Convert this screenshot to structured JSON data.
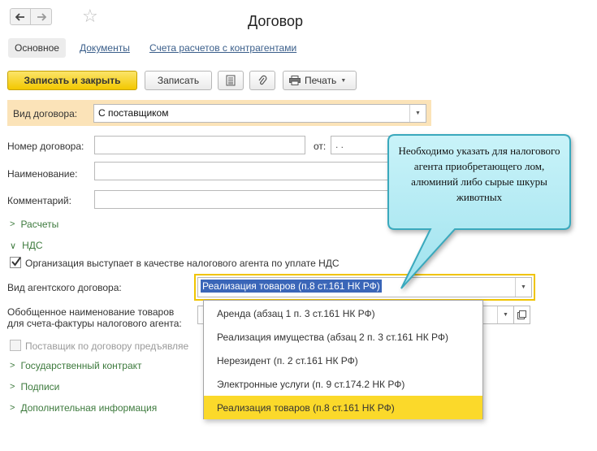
{
  "window": {
    "title": "Договор"
  },
  "nav": {
    "back_icon": "arrow-left-icon",
    "forward_icon": "arrow-right-icon",
    "favorite_icon": "star-icon"
  },
  "tabs": [
    {
      "label": "Основное",
      "active": true
    },
    {
      "label": "Документы",
      "active": false
    },
    {
      "label": "Счета расчетов с контрагентами",
      "active": false
    }
  ],
  "toolbar": {
    "save_close_label": "Записать и закрыть",
    "save_label": "Записать",
    "list_icon": "list-icon",
    "attach_icon": "paperclip-icon",
    "print_label": "Печать"
  },
  "form": {
    "contract_type_label": "Вид договора:",
    "contract_type_value": "С поставщиком",
    "number_label": "Номер договора:",
    "number_value": "",
    "date_label": "от:",
    "date_value": ". .",
    "name_label": "Наименование:",
    "name_value": "",
    "comment_label": "Комментарий:",
    "comment_value": ""
  },
  "sections": {
    "payments": "Расчеты",
    "vat": "НДС",
    "state_contract": "Государственный контракт",
    "signatures": "Подписи",
    "additional": "Дополнительная информация"
  },
  "vat": {
    "agent_checkbox_label": "Организация выступает в качестве налогового агента по уплате НДС",
    "agent_checked": true,
    "agent_contract_label": "Вид агентского договора:",
    "agent_contract_value": "Реализация товаров (п.8 ст.161 НК РФ)",
    "goods_name_label_1": "Обобщенное наименование товаров",
    "goods_name_label_2": "для счета-фактуры налогового агента:",
    "supplier_checkbox_label": "Поставщик по договору предъявляе"
  },
  "dropdown": {
    "items": [
      "Аренда (абзац 1 п. 3 ст.161 НК РФ)",
      "Реализация имущества (абзац 2 п. 3 ст.161 НК РФ)",
      "Нерезидент (п. 2 ст.161 НК РФ)",
      "Электронные услуги (п. 9 ст.174.2 НК РФ)",
      "Реализация товаров (п.8 ст.161 НК РФ)"
    ],
    "selected_index": 4
  },
  "callout": {
    "text": "Необходимо указать для налогового агента приобретающего лом, алюминий либо сырые шкуры животных"
  },
  "colors": {
    "accent_yellow": "#f3c800",
    "highlight_band": "#fbe3b8",
    "section_green": "#3d7a3d",
    "link_blue": "#3a5e8a",
    "callout_fill": "#b5ecf4",
    "callout_border": "#3aa9bd",
    "selection_blue": "#3a66b8"
  }
}
